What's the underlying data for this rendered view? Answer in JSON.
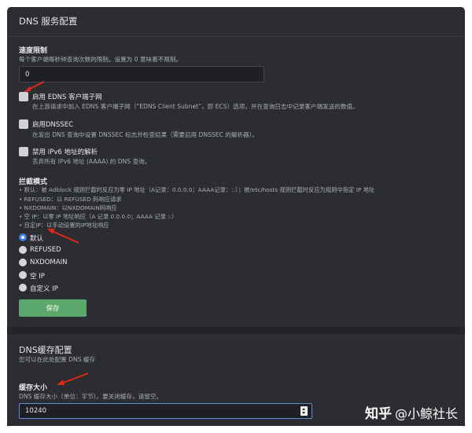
{
  "dns_service": {
    "title": "DNS 服务配置",
    "rate_limit": {
      "label": "速度限制",
      "desc": "每个客户端每秒钟查询次数的限制。设置为 0 意味着不限制。",
      "value": "0"
    },
    "options": [
      {
        "title": "启用 EDNS 客户端子网",
        "desc": "在上游请求中加入 EDNS 客户端子网（“EDNS Client Subnet”，即 ECS）选项，并在查询日志中记录客户端发送的数值。"
      },
      {
        "title": "启用DNSSEC",
        "desc": "在发出 DNS 查询中设置 DNSSEC 标志并检查结果（需要启用 DNSSEC 的解析器）。"
      },
      {
        "title": "禁用 IPv6 地址的解析",
        "desc": "丢弃所有 IPv6 地址 (AAAA) 的 DNS 查询。"
      }
    ],
    "blocking_mode": {
      "label": "拦截模式",
      "bullets": [
        "默认：被 Adblock 规则拦截时反应为零 IP 地址（A记录：0.0.0.0；AAAA记录：::）；被/etc/hosts 规则拦截时反应为规则中指定 IP 地址",
        "REFUSED：以 REFUSED 码响应请求",
        "NXDOMAIN：以NXDOMAIN码响应",
        "空 IP：以零 IP 地址响应（A 记录 0.0.0.0；AAAA 记录 ::）",
        "自定IP：以手动设置的IP地址响应"
      ],
      "radios": [
        "默认",
        "REFUSED",
        "NXDOMAIN",
        "空 IP",
        "自定义 IP"
      ],
      "selected": "默认"
    },
    "save_label": "保存"
  },
  "dns_cache": {
    "title": "DNS缓存配置",
    "subtitle": "您可以在此处配置 DNS 缓存",
    "cache_size": {
      "label": "缓存大小",
      "desc": "DNS 缓存大小（单位：字节）。要关闭缓存，请留空。",
      "value": "10240"
    }
  },
  "watermark": {
    "brand": "知乎",
    "author": "@小鲸社长"
  },
  "colors": {
    "panel_bg": "#2b2d30",
    "input_bg": "#1f2023",
    "save_button": "#5ca86c",
    "radio_selected": "#3d7fe0",
    "annotation_arrow": "#e0271c"
  }
}
